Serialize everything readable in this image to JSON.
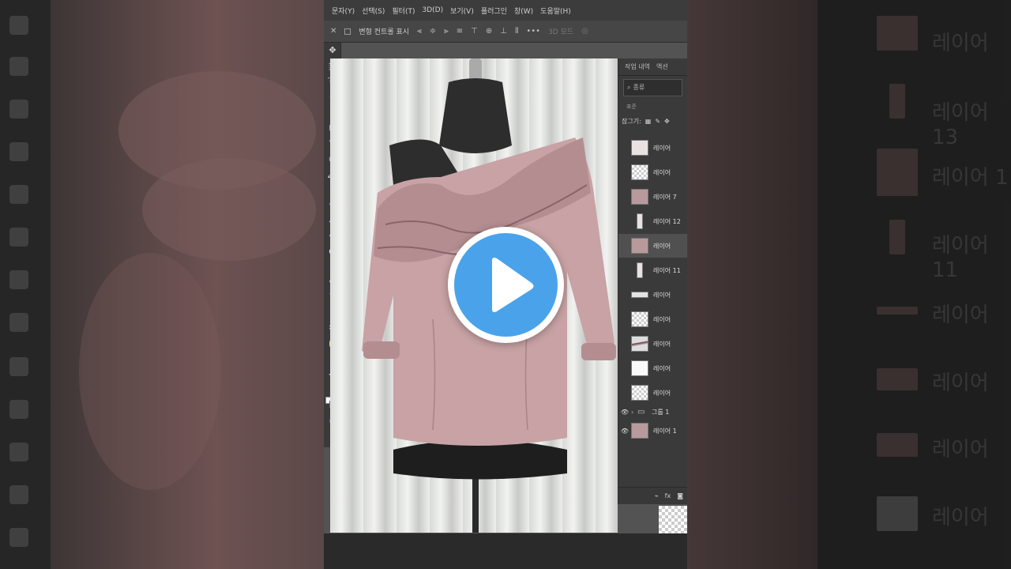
{
  "menu": [
    "문자(Y)",
    "선택(S)",
    "필터(T)",
    "3D(D)",
    "보기(V)",
    "플러그인",
    "창(W)",
    "도움말(H)"
  ],
  "options_bar": {
    "auto_select_checkbox": "",
    "show_transform_label": "변형 컨트롤 표시",
    "mode_label": "3D 모드"
  },
  "tools": [
    "move-icon",
    "marquee-icon",
    "lasso-icon",
    "magic-wand-icon",
    "crop-icon",
    "frame-icon",
    "eyedropper-icon",
    "spot-heal-icon",
    "brush-icon",
    "stamp-icon",
    "history-brush-icon",
    "eraser-icon",
    "bucket-icon",
    "blur-icon",
    "dodge-icon",
    "pen-icon",
    "type-icon",
    "path-select-icon",
    "shape-icon",
    "hand-icon",
    "zoom-icon",
    "more-icon"
  ],
  "panel": {
    "tabs": [
      "작업 내역",
      "액션"
    ],
    "filter_label": "종류",
    "blend_mode": "표준",
    "lock_label": "잠그기:"
  },
  "layers": [
    {
      "name": "레이어",
      "thumb": "photo",
      "visible": false,
      "selected": false
    },
    {
      "name": "레이어",
      "thumb": "transparent",
      "visible": false,
      "selected": false
    },
    {
      "name": "레이어 7",
      "thumb": "pink",
      "visible": false,
      "selected": false
    },
    {
      "name": "레이어 12",
      "thumb": "narrow",
      "visible": false,
      "selected": false
    },
    {
      "name": "레이어",
      "thumb": "pink",
      "visible": false,
      "selected": true
    },
    {
      "name": "레이어 11",
      "thumb": "narrow",
      "visible": false,
      "selected": false
    },
    {
      "name": "레이어",
      "thumb": "flat",
      "visible": false,
      "selected": false
    },
    {
      "name": "레이어",
      "thumb": "transparent",
      "visible": false,
      "selected": false
    },
    {
      "name": "레이어",
      "thumb": "dark",
      "visible": false,
      "selected": false
    },
    {
      "name": "레이어",
      "thumb": "white",
      "visible": false,
      "selected": false
    },
    {
      "name": "레이어",
      "thumb": "transparent",
      "visible": false,
      "selected": false
    },
    {
      "name": "그룹 1",
      "thumb": "folder",
      "visible": true,
      "selected": false
    },
    {
      "name": "레이어 1",
      "thumb": "photo",
      "visible": true,
      "selected": false
    }
  ],
  "footer_icons": [
    "fx-icon",
    "mask-icon"
  ],
  "bg_right_labels": [
    "레이어",
    "레이어 13",
    "레이어 1",
    "레이어 11",
    "레이어",
    "레이어",
    "레이어",
    "레이어"
  ],
  "colors": {
    "play_fill": "#4aa3ea",
    "blouse_pink": "#c8a2a4",
    "panel_bg": "#3a3a3a"
  }
}
